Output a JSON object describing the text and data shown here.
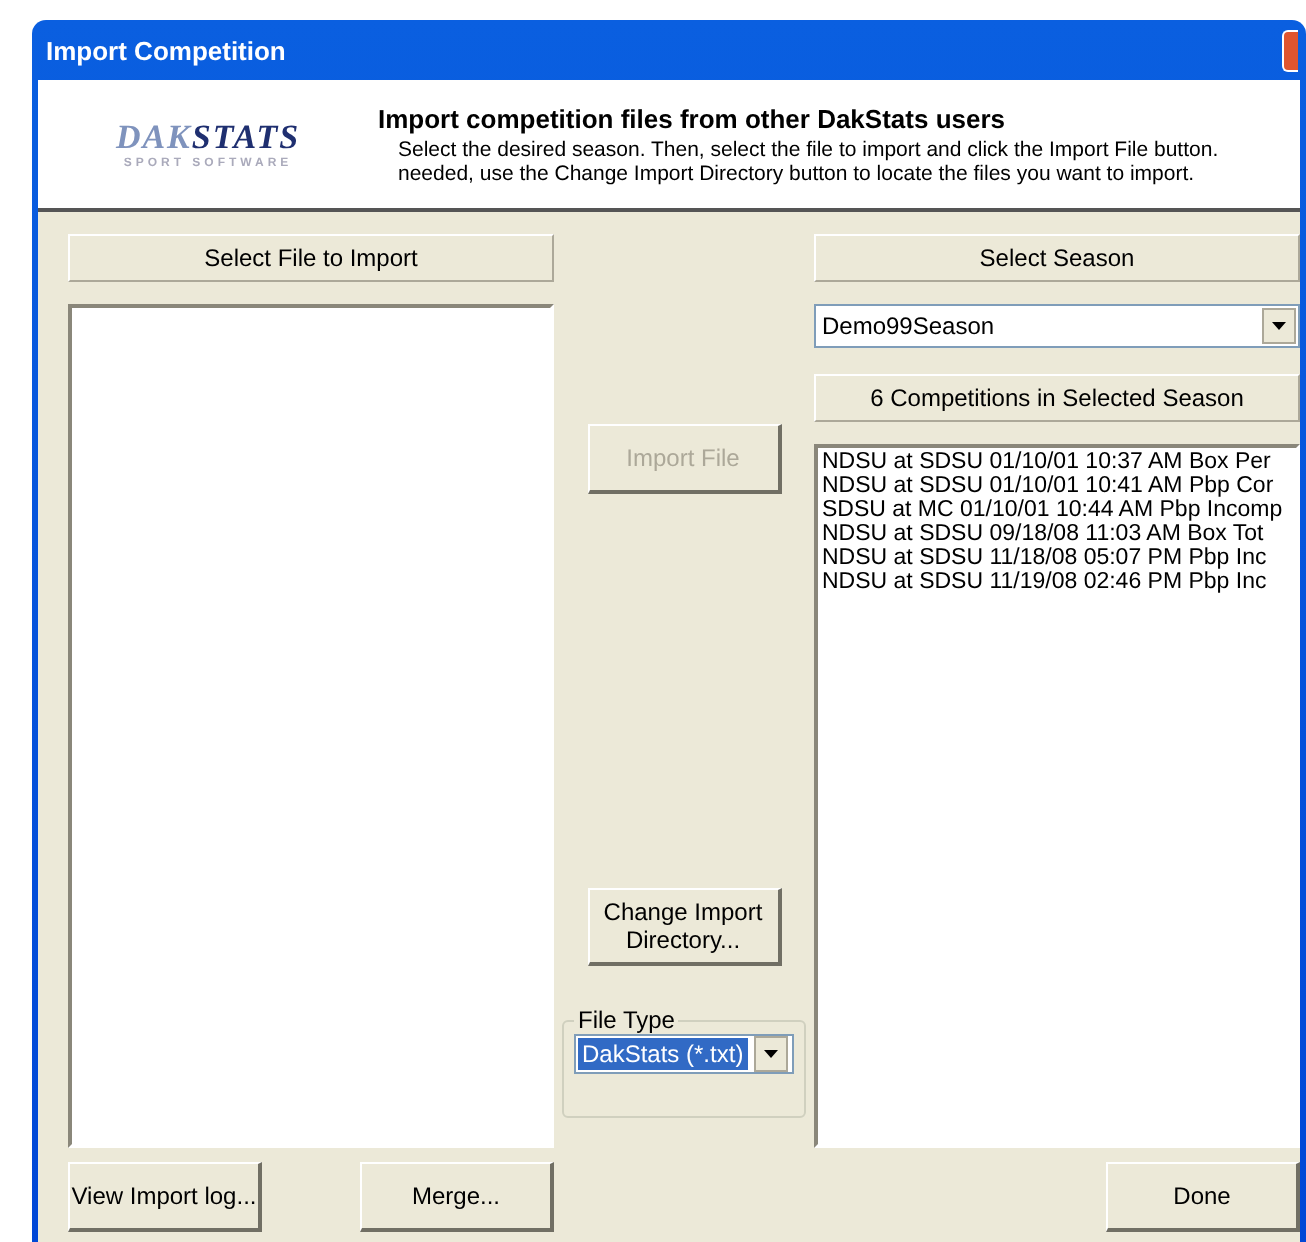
{
  "window": {
    "title": "Import Competition"
  },
  "header": {
    "logo": {
      "word_1": "DAK",
      "word_2": "STATS",
      "tagline": "SPORT SOFTWARE"
    },
    "heading": "Import competition files from other DakStats users",
    "lines": [
      "Select the desired season. Then, select the file to import and click the Import File button.",
      "needed, use the Change Import Directory button to locate the files you want to import."
    ]
  },
  "file_panel": {
    "label": "Select File to Import"
  },
  "middle": {
    "import_button": {
      "label": "Import File",
      "disabled": true
    },
    "directory_button": {
      "lines": [
        "Change Import",
        "Directory..."
      ]
    },
    "file_type": {
      "legend": "File Type",
      "value": "DakStats (*.txt)",
      "highlighted": true
    }
  },
  "season_panel": {
    "label": "Select Season",
    "season": {
      "value": "Demo99Season"
    },
    "count_label": "6 Competitions in Selected Season",
    "competitions": [
      {
        "text": "NDSU at SDSU 01/10/01 10:37 AM  Box Per"
      },
      {
        "text": "NDSU at SDSU 01/10/01 10:41 AM  Pbp Cor"
      },
      {
        "text": "SDSU at MC 01/10/01 10:44 AM  Pbp Incomp"
      },
      {
        "text": "NDSU at SDSU 09/18/08 11:03 AM  Box Tot"
      },
      {
        "text": "NDSU at SDSU 11/18/08 05:07 PM  Pbp Inc"
      },
      {
        "text": "NDSU at SDSU 11/19/08 02:46 PM  Pbp Inc"
      }
    ]
  },
  "buttons": {
    "left": [
      "View Import log...",
      "Merge..."
    ],
    "right": [
      "Done"
    ]
  }
}
